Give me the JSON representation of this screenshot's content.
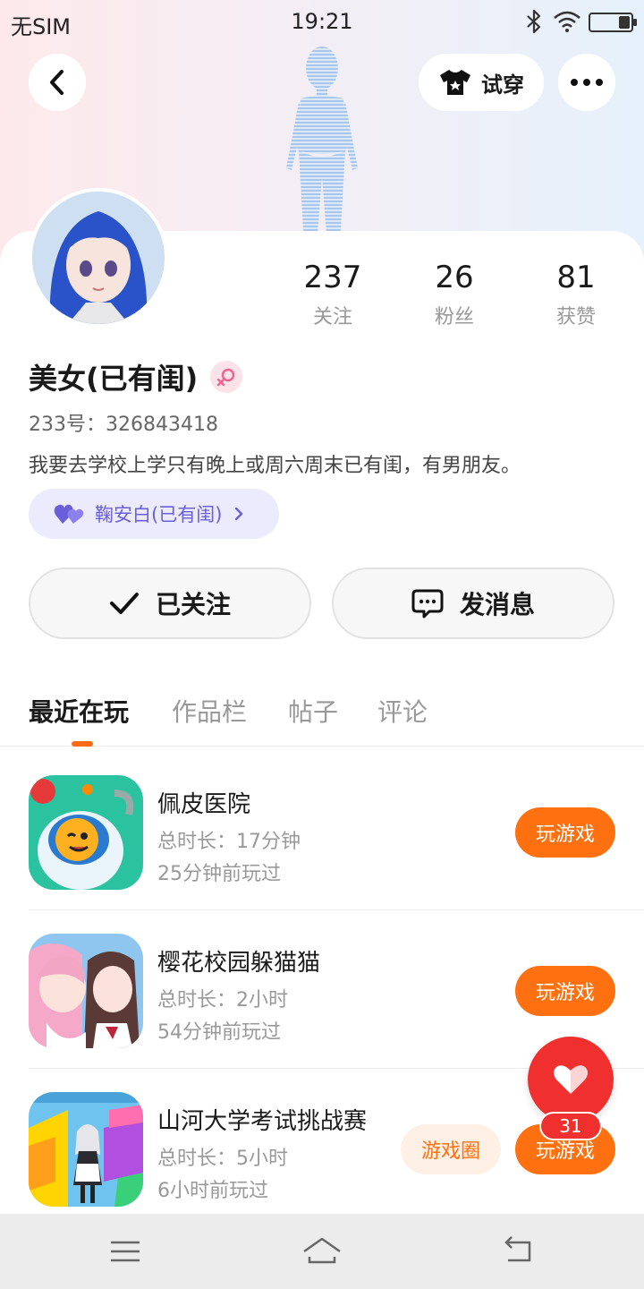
{
  "status_bar": {
    "carrier": "无SIM",
    "time": "19:21"
  },
  "header": {
    "try_on_label": "试穿"
  },
  "profile": {
    "name": "美女(已有闺)",
    "uid": "233号：326843418",
    "bio": "我要去学校上学只有晚上或周六周末已有闺，有男朋友。",
    "relation_label": "鞠安白(已有闺)"
  },
  "stats": [
    {
      "value": "237",
      "label": "关注"
    },
    {
      "value": "26",
      "label": "粉丝"
    },
    {
      "value": "81",
      "label": "获赞"
    }
  ],
  "actions": {
    "follow_label": "已关注",
    "message_label": "发消息"
  },
  "tabs": [
    {
      "label": "最近在玩",
      "active": true
    },
    {
      "label": "作品栏",
      "active": false
    },
    {
      "label": "帖子",
      "active": false
    },
    {
      "label": "评论",
      "active": false
    }
  ],
  "games": [
    {
      "title": "佩皮医院",
      "duration": "总时长：17分钟",
      "last_played": "25分钟前玩过",
      "play_label": "玩游戏"
    },
    {
      "title": "樱花校园躲猫猫",
      "duration": "总时长：2小时",
      "last_played": "54分钟前玩过",
      "play_label": "玩游戏"
    },
    {
      "title": "山河大学考试挑战赛",
      "duration": "总时长：5小时",
      "last_played": "6小时前玩过",
      "play_label": "玩游戏",
      "circle_label": "游戏圈"
    }
  ],
  "like_fab": {
    "count": "31"
  },
  "colors": {
    "accent": "#ff7010",
    "like": "#f0302e",
    "relation": "#6a5fd8"
  }
}
